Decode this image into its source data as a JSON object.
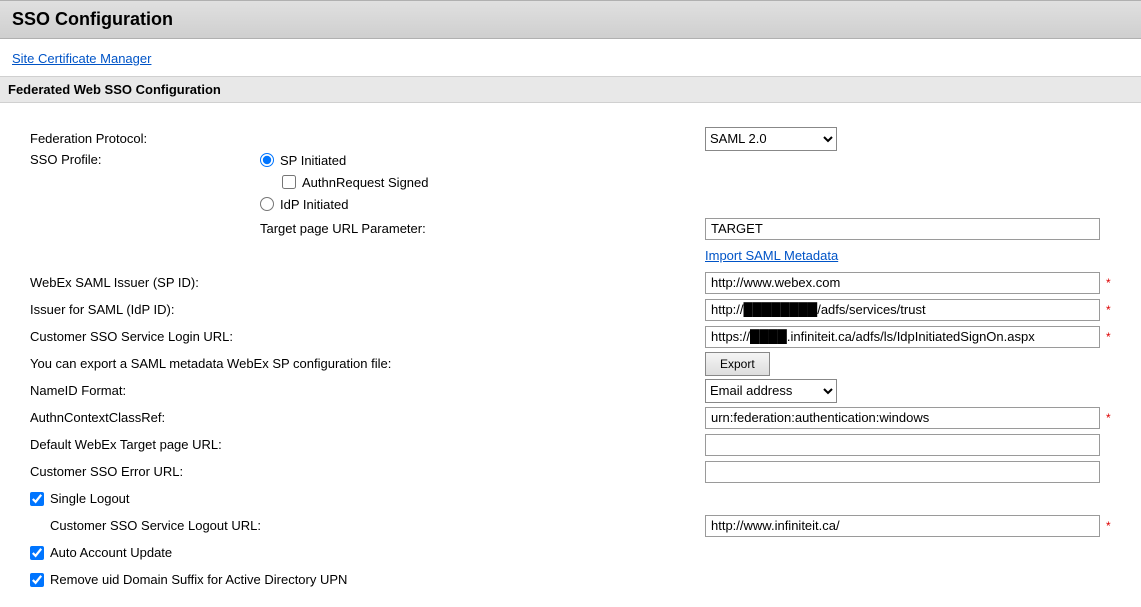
{
  "page": {
    "title": "SSO Configuration",
    "site_cert_link": "Site Certificate Manager",
    "section_title": "Federated Web SSO Configuration"
  },
  "labels": {
    "federation_protocol": "Federation Protocol:",
    "sso_profile": "SSO Profile:",
    "sp_initiated": "SP Initiated",
    "authn_request_signed": "AuthnRequest Signed",
    "idp_initiated": "IdP Initiated",
    "target_page_url_param": "Target page URL Parameter:",
    "import_saml_metadata": "Import SAML Metadata",
    "sp_id": "WebEx SAML Issuer (SP ID):",
    "idp_id": "Issuer for SAML (IdP ID):",
    "login_url": "Customer SSO Service Login URL:",
    "export_note": "You can export a SAML metadata WebEx SP configuration file:",
    "export_btn": "Export",
    "nameid_format": "NameID Format:",
    "authn_ctx": "AuthnContextClassRef:",
    "default_target": "Default WebEx Target page URL:",
    "error_url": "Customer SSO Error URL:",
    "single_logout": "Single Logout",
    "logout_url": "Customer SSO Service Logout URL:",
    "auto_account_update": "Auto Account Update",
    "remove_uid_suffix": "Remove uid Domain Suffix for Active Directory UPN"
  },
  "values": {
    "federation_protocol": "SAML 2.0",
    "target_param": "TARGET",
    "sp_id": "http://www.webex.com",
    "idp_id": "http://████████/adfs/services/trust",
    "login_url": "https://████.infiniteit.ca/adfs/ls/IdpInitiatedSignOn.aspx",
    "nameid_format": "Email address",
    "authn_ctx": "urn:federation:authentication:windows",
    "default_target": "",
    "error_url": "",
    "logout_url": "http://www.infiniteit.ca/"
  },
  "state": {
    "sso_profile": "sp",
    "authn_request_signed": false,
    "single_logout": true,
    "auto_account_update": true,
    "remove_uid_suffix": true
  }
}
